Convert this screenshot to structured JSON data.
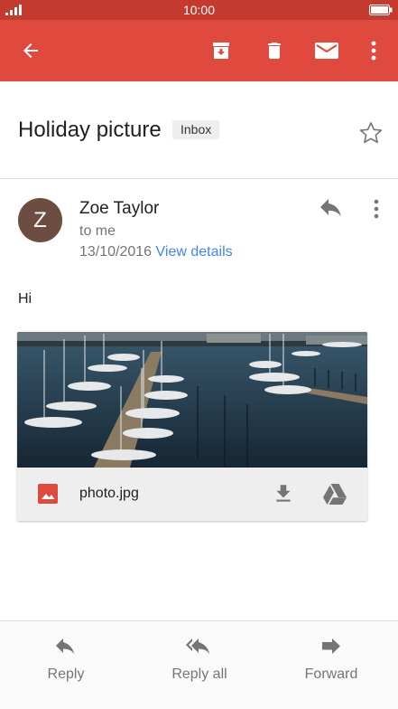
{
  "status_bar": {
    "time": "10:00"
  },
  "message": {
    "subject": "Holiday picture",
    "label": "Inbox",
    "sender": {
      "avatar_letter": "Z",
      "name": "Zoe Taylor",
      "recipient": "to me",
      "date": "13/10/2016",
      "view_details": "View details"
    },
    "body": "Hi",
    "attachment": {
      "filename": "photo.jpg"
    }
  },
  "bottom_actions": {
    "reply": "Reply",
    "reply_all": "Reply all",
    "forward": "Forward"
  },
  "colors": {
    "status_bar": "#c53a2f",
    "app_bar": "#e04a3e",
    "avatar": "#6d4c41",
    "link": "#4285f4"
  }
}
